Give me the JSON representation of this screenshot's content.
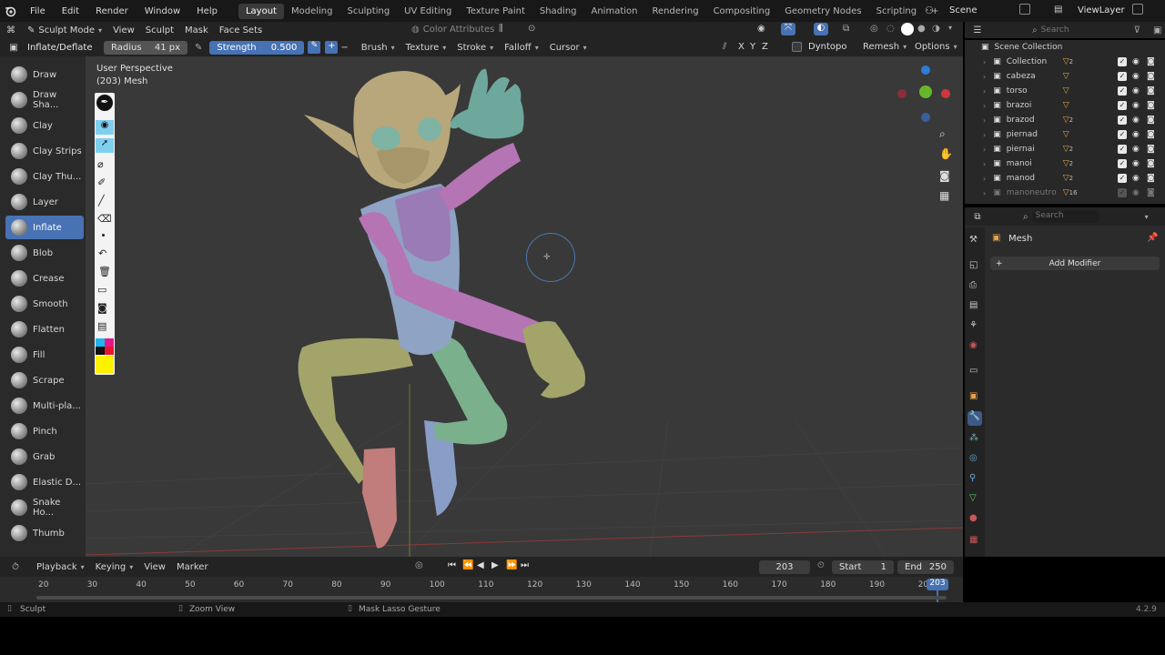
{
  "menu": {
    "items": [
      "File",
      "Edit",
      "Render",
      "Window",
      "Help"
    ],
    "workspaces": [
      "Layout",
      "Modeling",
      "Sculpting",
      "UV Editing",
      "Texture Paint",
      "Shading",
      "Animation",
      "Rendering",
      "Compositing",
      "Geometry Nodes",
      "Scripting"
    ],
    "active_workspace": "Layout",
    "add_tab": "+",
    "scene": "Scene",
    "view_layer": "ViewLayer"
  },
  "viewport_header": {
    "mode": "Sculpt Mode",
    "menus": [
      "View",
      "Sculpt",
      "Mask",
      "Face Sets"
    ],
    "color_attributes": "Color Attributes"
  },
  "tool_settings": {
    "brush_name": "Inflate/Deflate",
    "radius_label": "Radius",
    "radius_value": "41 px",
    "strength_label": "Strength",
    "strength_value": "0.500",
    "plus": "+",
    "minus": "−",
    "menus": [
      "Brush",
      "Texture",
      "Stroke",
      "Falloff",
      "Cursor"
    ],
    "axes": [
      "X",
      "Y",
      "Z"
    ],
    "dyntopo": "Dyntopo",
    "remesh": "Remesh",
    "options": "Options"
  },
  "tools": [
    {
      "label": "Draw",
      "active": false
    },
    {
      "label": "Draw Sha...",
      "active": false
    },
    {
      "label": "Clay",
      "active": false
    },
    {
      "label": "Clay Strips",
      "active": false
    },
    {
      "label": "Clay Thu...",
      "active": false
    },
    {
      "label": "Layer",
      "active": false
    },
    {
      "label": "Inflate",
      "active": true
    },
    {
      "label": "Blob",
      "active": false
    },
    {
      "label": "Crease",
      "active": false
    },
    {
      "label": "Smooth",
      "active": false
    },
    {
      "label": "Flatten",
      "active": false
    },
    {
      "label": "Fill",
      "active": false
    },
    {
      "label": "Scrape",
      "active": false
    },
    {
      "label": "Multi-pla...",
      "active": false
    },
    {
      "label": "Pinch",
      "active": false
    },
    {
      "label": "Grab",
      "active": false
    },
    {
      "label": "Elastic D...",
      "active": false
    },
    {
      "label": "Snake Ho...",
      "active": false
    },
    {
      "label": "Thumb",
      "active": false
    }
  ],
  "viewport": {
    "view_name": "User Perspective",
    "object_info": "(203) Mesh"
  },
  "outliner": {
    "search_placeholder": "Search",
    "scene_collection": "Scene Collection",
    "rows": [
      {
        "name": "Collection",
        "badge": "2",
        "badge2": "10"
      },
      {
        "name": "cabeza",
        "badge": ""
      },
      {
        "name": "torso",
        "badge": ""
      },
      {
        "name": "brazoi",
        "badge": ""
      },
      {
        "name": "brazod",
        "badge": "2"
      },
      {
        "name": "piernad",
        "badge": ""
      },
      {
        "name": "piernai",
        "badge": "2"
      },
      {
        "name": "manoi",
        "badge": "2"
      },
      {
        "name": "manod",
        "badge": "2"
      },
      {
        "name": "manoneutro",
        "badge": "16"
      }
    ]
  },
  "properties": {
    "search_placeholder": "Search",
    "object_name": "Mesh",
    "add_modifier": "Add Modifier"
  },
  "timeline": {
    "menus": [
      "Playback",
      "Keying",
      "View",
      "Marker"
    ],
    "current_frame": "203",
    "start_label": "Start",
    "start_value": "1",
    "end_label": "End",
    "end_value": "250",
    "ruler": [
      "20",
      "30",
      "40",
      "50",
      "60",
      "70",
      "80",
      "90",
      "100",
      "110",
      "120",
      "130",
      "140",
      "150",
      "160",
      "170",
      "180",
      "190",
      "20"
    ],
    "playhead": "203"
  },
  "statusbar": {
    "left": "Sculpt",
    "middle": "Zoom View",
    "right_action": "Mask Lasso Gesture",
    "version": "4.2.9"
  },
  "colors": {
    "accent": "#4772b3",
    "head": "#b8a77a",
    "eyes": "#7fb3a4",
    "torso_blue": "#8fa3c4",
    "torso_purple": "#9a7bb5",
    "arm_pink": "#b574b3",
    "hand_teal": "#6ea79c",
    "leg_olive": "#a3a46a",
    "leg_green": "#7ab08c",
    "foot_red": "#c07d7b",
    "foot_blue": "#8a9dc6"
  }
}
